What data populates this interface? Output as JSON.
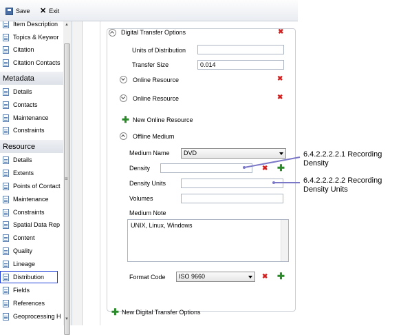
{
  "toolbar": {
    "save_label": "Save",
    "exit_label": "Exit"
  },
  "sidebar": {
    "top_items": [
      "Item Description",
      "Topics & Keywor",
      "Citation",
      "Citation Contacts"
    ],
    "metadata_header": "Metadata",
    "metadata_items": [
      "Details",
      "Contacts",
      "Maintenance",
      "Constraints"
    ],
    "resource_header": "Resource",
    "resource_items": [
      "Details",
      "Extents",
      "Points of Contact",
      "Maintenance",
      "Constraints",
      "Spatial Data Rep",
      "Content",
      "Quality",
      "Lineage",
      "Distribution",
      "Fields",
      "References",
      "Geoprocessing H"
    ],
    "selected": "Distribution"
  },
  "panel": {
    "digital_transfer_options": "Digital Transfer Options",
    "units_of_distribution_label": "Units of Distribution",
    "units_of_distribution_value": "",
    "transfer_size_label": "Transfer Size",
    "transfer_size_value": "0.014",
    "online_resource_1": "Online Resource",
    "online_resource_2": "Online Resource",
    "new_online_resource": "New Online Resource",
    "offline_medium": "Offline Medium",
    "medium_name_label": "Medium Name",
    "medium_name_value": "DVD",
    "density_label": "Density",
    "density_value": "",
    "density_units_label": "Density Units",
    "density_units_value": "",
    "volumes_label": "Volumes",
    "volumes_value": "",
    "medium_note_label": "Medium Note",
    "medium_note_value": "UNIX, Linux, Windows",
    "format_code_label": "Format Code",
    "format_code_value": "ISO 9660",
    "new_digital_transfer_options": "New Digital Transfer Options"
  },
  "callouts": {
    "c1_line1": "6.4.2.2.2.2.1 Recording",
    "c1_line2": "Density",
    "c2_line1": "6.4.2.2.2.2.2 Recording",
    "c2_line2": "Density Units"
  },
  "colors": {
    "callout_line": "#7b78c8",
    "delete": "#d02020",
    "add": "#2a8a2a",
    "selection": "#1f3fd6"
  }
}
